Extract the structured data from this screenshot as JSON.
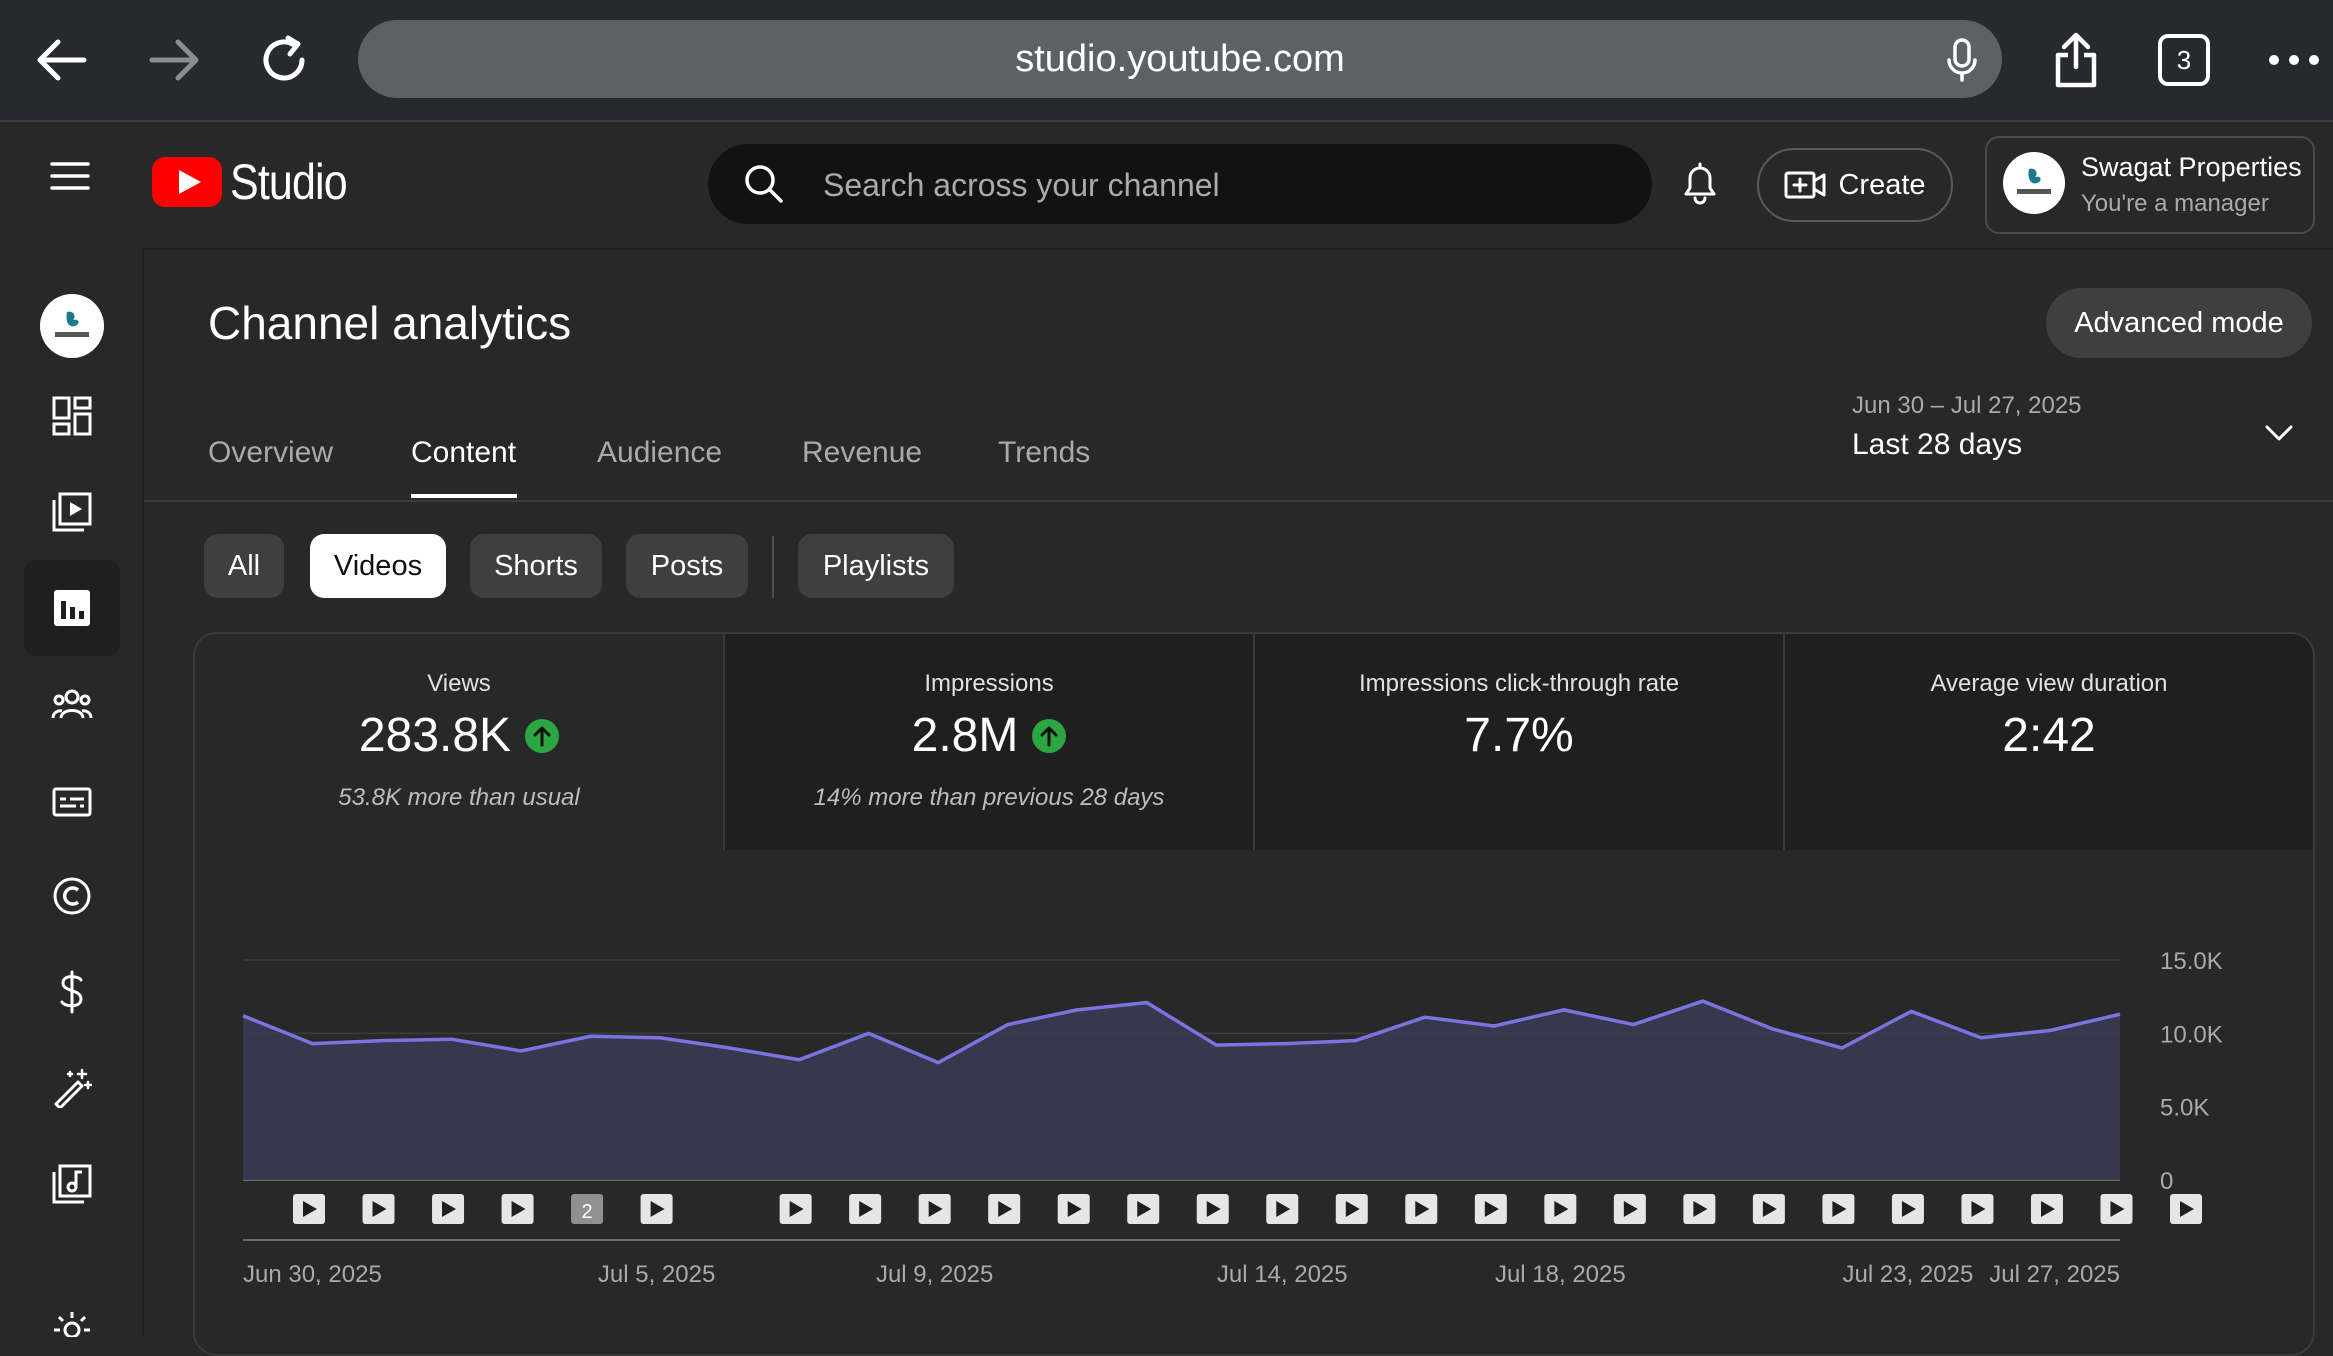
{
  "browser": {
    "url": "studio.youtube.com",
    "tab_count": "3"
  },
  "header": {
    "logo_text": "Studio",
    "search_placeholder": "Search across your channel",
    "create_label": "Create",
    "account_name": "Swagat Properties",
    "account_role": "You're a manager"
  },
  "page": {
    "title": "Channel analytics",
    "advanced_mode_label": "Advanced mode",
    "tabs": [
      {
        "label": "Overview"
      },
      {
        "label": "Content"
      },
      {
        "label": "Audience"
      },
      {
        "label": "Revenue"
      },
      {
        "label": "Trends"
      }
    ],
    "active_tab": "Content",
    "date_range": "Jun 30 – Jul 27, 2025",
    "date_label": "Last 28 days",
    "chips": [
      {
        "label": "All"
      },
      {
        "label": "Videos"
      },
      {
        "label": "Shorts"
      },
      {
        "label": "Posts"
      },
      {
        "label": "Playlists"
      }
    ],
    "active_chip": "Videos"
  },
  "metrics": [
    {
      "label": "Views",
      "value": "283.8K",
      "trend": "up",
      "sub": "53.8K more than usual"
    },
    {
      "label": "Impressions",
      "value": "2.8M",
      "trend": "up",
      "sub": "14% more than previous 28 days"
    },
    {
      "label": "Impressions click-through rate",
      "value": "7.7%"
    },
    {
      "label": "Average view duration",
      "value": "2:42"
    }
  ],
  "colors": {
    "accent": "#7b74e0",
    "area_fill": "#3a3a55",
    "up_badge": "#2ba640",
    "youtube_red": "#ff0000"
  },
  "chart_data": {
    "type": "area",
    "x": [
      "Jun 30",
      "Jul 1",
      "Jul 2",
      "Jul 3",
      "Jul 4",
      "Jul 5",
      "Jul 6",
      "Jul 7",
      "Jul 8",
      "Jul 9",
      "Jul 10",
      "Jul 11",
      "Jul 12",
      "Jul 13",
      "Jul 14",
      "Jul 15",
      "Jul 16",
      "Jul 17",
      "Jul 18",
      "Jul 19",
      "Jul 20",
      "Jul 21",
      "Jul 22",
      "Jul 23",
      "Jul 24",
      "Jul 25",
      "Jul 26",
      "Jul 27"
    ],
    "series": [
      {
        "values": [
          11200,
          9300,
          9500,
          9600,
          8800,
          9800,
          9700,
          9000,
          8200,
          10000,
          8000,
          10600,
          11600,
          12100,
          9200,
          9300,
          9500,
          11100,
          10500,
          11600,
          10600,
          12200,
          10300,
          9000,
          11500,
          9700,
          10200,
          11300
        ]
      }
    ],
    "x_tick_labels": [
      "Jun 30, 2025",
      "Jul 5, 2025",
      "Jul 9, 2025",
      "Jul 14, 2025",
      "Jul 18, 2025",
      "Jul 23, 2025",
      "Jul 27, 2025"
    ],
    "x_tick_dates": [
      "Jun 30",
      "Jul 5",
      "Jul 9",
      "Jul 14",
      "Jul 18",
      "Jul 23",
      "Jul 27"
    ],
    "y_tick_labels": [
      "0",
      "5.0K",
      "10.0K",
      "15.0K"
    ],
    "y_ticks": [
      0,
      5000,
      10000,
      15000
    ],
    "ylim": [
      0,
      15000
    ],
    "grid": true,
    "upload_markers": [
      {
        "date": "Jun 30",
        "label": ""
      },
      {
        "date": "Jul 1",
        "label": ""
      },
      {
        "date": "Jul 2",
        "label": ""
      },
      {
        "date": "Jul 3",
        "label": ""
      },
      {
        "date": "Jul 4",
        "label": "2"
      },
      {
        "date": "Jul 5",
        "label": ""
      },
      {
        "date": "Jul 7",
        "label": ""
      },
      {
        "date": "Jul 8",
        "label": ""
      },
      {
        "date": "Jul 9",
        "label": ""
      },
      {
        "date": "Jul 10",
        "label": ""
      },
      {
        "date": "Jul 11",
        "label": ""
      },
      {
        "date": "Jul 12",
        "label": ""
      },
      {
        "date": "Jul 13",
        "label": ""
      },
      {
        "date": "Jul 14",
        "label": ""
      },
      {
        "date": "Jul 15",
        "label": ""
      },
      {
        "date": "Jul 16",
        "label": ""
      },
      {
        "date": "Jul 17",
        "label": ""
      },
      {
        "date": "Jul 18",
        "label": ""
      },
      {
        "date": "Jul 19",
        "label": ""
      },
      {
        "date": "Jul 20",
        "label": ""
      },
      {
        "date": "Jul 21",
        "label": ""
      },
      {
        "date": "Jul 22",
        "label": ""
      },
      {
        "date": "Jul 23",
        "label": ""
      },
      {
        "date": "Jul 24",
        "label": ""
      },
      {
        "date": "Jul 25",
        "label": ""
      },
      {
        "date": "Jul 26",
        "label": ""
      },
      {
        "date": "Jul 27",
        "label": ""
      }
    ]
  }
}
